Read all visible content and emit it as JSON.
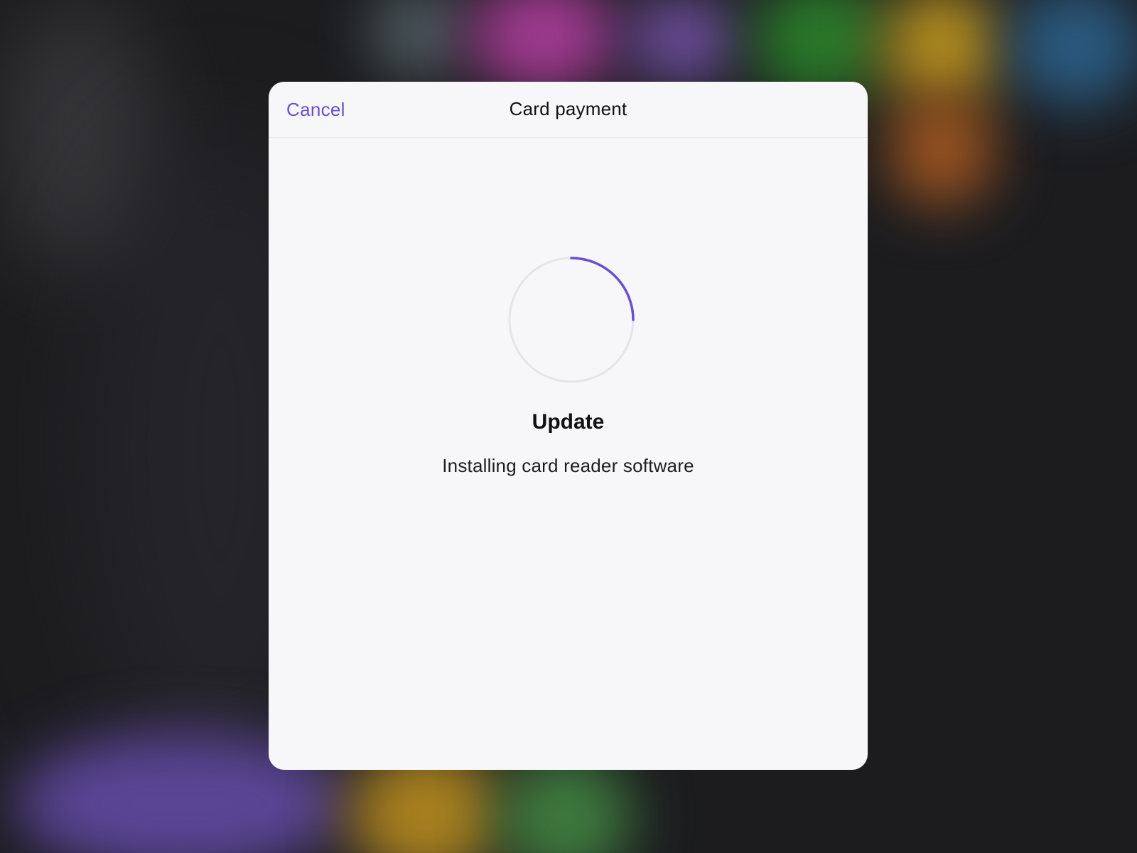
{
  "modal": {
    "cancel_label": "Cancel",
    "title": "Card payment",
    "heading": "Update",
    "message": "Installing card reader software"
  },
  "progress": {
    "fraction": 0.25,
    "accent_color": "#6a4fd0",
    "track_color": "#e4e4ea"
  }
}
